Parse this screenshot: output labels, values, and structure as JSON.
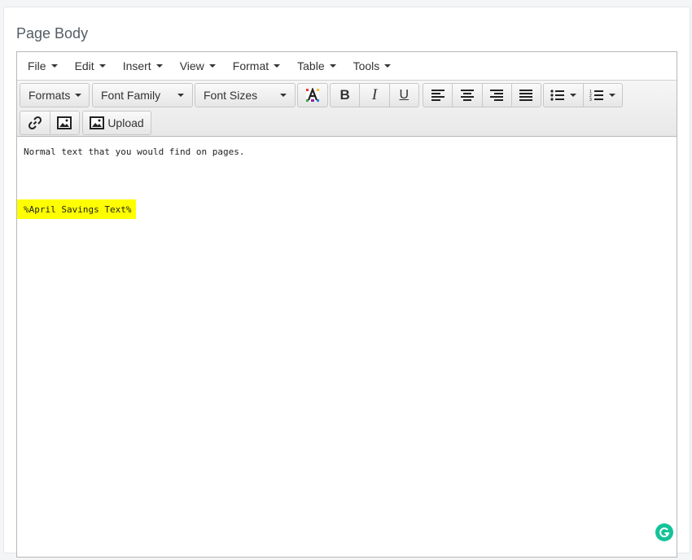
{
  "page": {
    "title": "Page Body"
  },
  "menubar": {
    "items": [
      {
        "label": "File"
      },
      {
        "label": "Edit"
      },
      {
        "label": "Insert"
      },
      {
        "label": "View"
      },
      {
        "label": "Format"
      },
      {
        "label": "Table"
      },
      {
        "label": "Tools"
      }
    ]
  },
  "toolbar": {
    "formats_label": "Formats",
    "font_family_label": "Font Family",
    "font_sizes_label": "Font Sizes",
    "upload_label": "Upload",
    "icons": {
      "text_color": "text-color-icon",
      "bold": "bold-icon",
      "italic": "italic-icon",
      "underline": "underline-icon",
      "align_left": "align-left-icon",
      "align_center": "align-center-icon",
      "align_right": "align-right-icon",
      "align_justify": "align-justify-icon",
      "bullet_list": "bullet-list-icon",
      "numbered_list": "numbered-list-icon",
      "link": "link-icon",
      "image": "image-icon",
      "upload": "upload-image-icon"
    }
  },
  "content": {
    "paragraph_1": "Normal text that you would find on pages.",
    "highlighted_text": "%April Savings Text%",
    "highlight_color": "#ffff00"
  },
  "grammarly": {
    "icon": "grammarly-icon",
    "color": "#15c39a"
  }
}
